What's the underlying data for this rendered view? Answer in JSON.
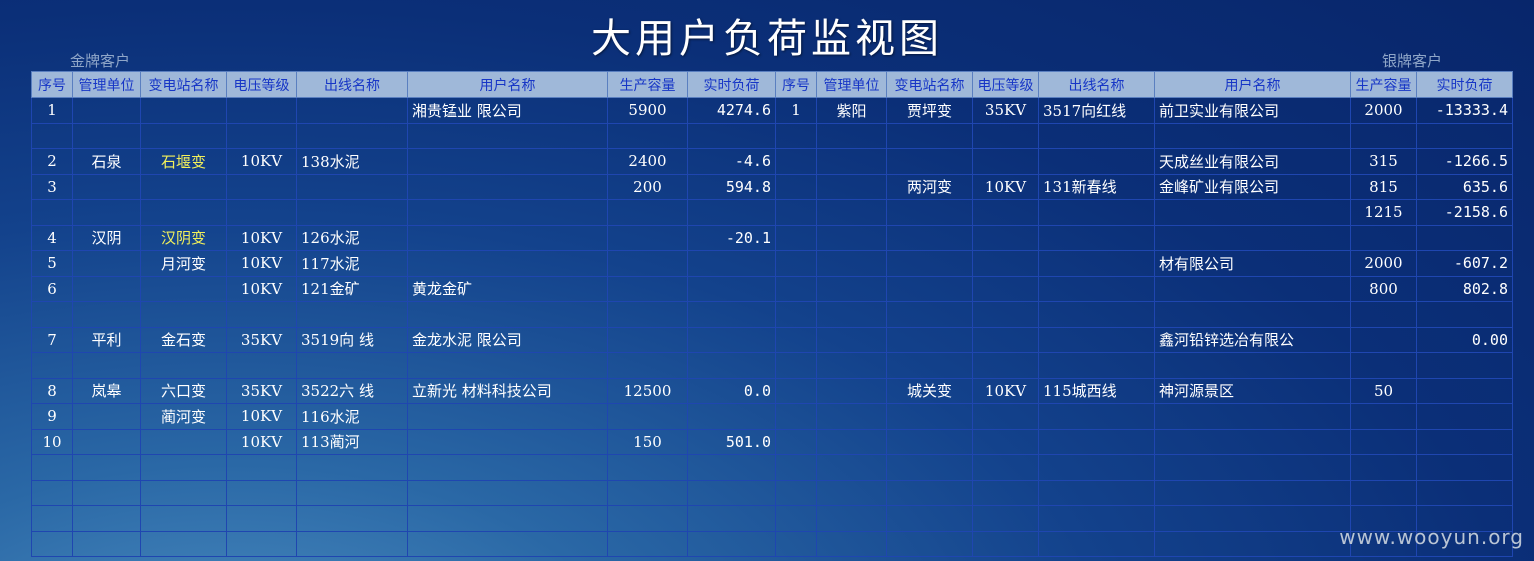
{
  "title": "大用户负荷监视图",
  "gold_label": "金牌客户",
  "silver_label": "银牌客户",
  "watermark": "www.wooyun.org",
  "headers": [
    "序号",
    "管理单位",
    "变电站名称",
    "电压等级",
    "出线名称",
    "用户名称",
    "生产容量",
    "实时负荷"
  ],
  "left": {
    "rows": [
      [
        "1",
        "",
        "",
        "",
        "",
        "湘贵锰业 限公司",
        "5900",
        "4274.6"
      ],
      [
        "",
        "",
        "",
        "",
        "",
        "",
        "",
        ""
      ],
      [
        "2",
        "石泉",
        "石堰变",
        "10KV",
        "138水泥",
        "",
        "2400",
        "-4.6"
      ],
      [
        "3",
        "",
        "",
        "",
        "",
        "",
        "200",
        "594.8"
      ],
      [
        "",
        "",
        "",
        "",
        "",
        "",
        "",
        ""
      ],
      [
        "4",
        "汉阴",
        "汉阴变",
        "10KV",
        "126水泥",
        "",
        "",
        "-20.1"
      ],
      [
        "5",
        "",
        "月河变",
        "10KV",
        "117水泥",
        "",
        "",
        ""
      ],
      [
        "6",
        "",
        "",
        "10KV",
        "121金矿",
        "黄龙金矿",
        "",
        ""
      ],
      [
        "",
        "",
        "",
        "",
        "",
        "",
        "",
        ""
      ],
      [
        "7",
        "平利",
        "金石变",
        "35KV",
        "3519向 线",
        "金龙水泥 限公司",
        "",
        ""
      ],
      [
        "",
        "",
        "",
        "",
        "",
        "",
        "",
        ""
      ],
      [
        "8",
        "岚皋",
        "六口变",
        "35KV",
        "3522六 线",
        "立新光 材料科技公司",
        "12500",
        "0.0"
      ],
      [
        "9",
        "",
        "蔺河变",
        "10KV",
        "116水泥",
        "",
        "",
        ""
      ],
      [
        "10",
        "",
        "",
        "10KV",
        "113蔺河",
        "",
        "150",
        "501.0"
      ],
      [
        "",
        "",
        "",
        "",
        "",
        "",
        "",
        ""
      ],
      [
        "",
        "",
        "",
        "",
        "",
        "",
        "",
        ""
      ],
      [
        "",
        "",
        "",
        "",
        "",
        "",
        "",
        ""
      ],
      [
        "",
        "",
        "",
        "",
        "",
        "",
        "",
        ""
      ]
    ]
  },
  "right": {
    "rows": [
      [
        "1",
        "紫阳",
        "贾坪变",
        "35KV",
        "3517向红线",
        "前卫实业有限公司",
        "2000",
        "-13333.4"
      ],
      [
        "",
        "",
        "",
        "",
        "",
        "",
        "",
        ""
      ],
      [
        "",
        "",
        "",
        "",
        "",
        "天成丝业有限公司",
        "315",
        "-1266.5"
      ],
      [
        "",
        "",
        "两河变",
        "10KV",
        "131新春线",
        "金峰矿业有限公司",
        "815",
        "635.6"
      ],
      [
        "",
        "",
        "",
        "",
        "",
        "",
        "1215",
        "-2158.6"
      ],
      [
        "",
        "",
        "",
        "",
        "",
        "",
        "",
        ""
      ],
      [
        "",
        "",
        "",
        "",
        "",
        "材有限公司",
        "2000",
        "-607.2"
      ],
      [
        "",
        "",
        "",
        "",
        "",
        "",
        "800",
        "802.8"
      ],
      [
        "",
        "",
        "",
        "",
        "",
        "",
        "",
        ""
      ],
      [
        "",
        "",
        "",
        "",
        "",
        "鑫河铅锌选冶有限公",
        "",
        "0.00"
      ],
      [
        "",
        "",
        "",
        "",
        "",
        "",
        "",
        ""
      ],
      [
        "",
        "",
        "城关变",
        "10KV",
        "115城西线",
        "神河源景区",
        "50",
        ""
      ],
      [
        "",
        "",
        "",
        "",
        "",
        "",
        "",
        ""
      ],
      [
        "",
        "",
        "",
        "",
        "",
        "",
        "",
        ""
      ],
      [
        "",
        "",
        "",
        "",
        "",
        "",
        "",
        ""
      ],
      [
        "",
        "",
        "",
        "",
        "",
        "",
        "",
        ""
      ],
      [
        "",
        "",
        "",
        "",
        "",
        "",
        "",
        ""
      ],
      [
        "",
        "",
        "",
        "",
        "",
        "",
        "",
        ""
      ]
    ]
  }
}
